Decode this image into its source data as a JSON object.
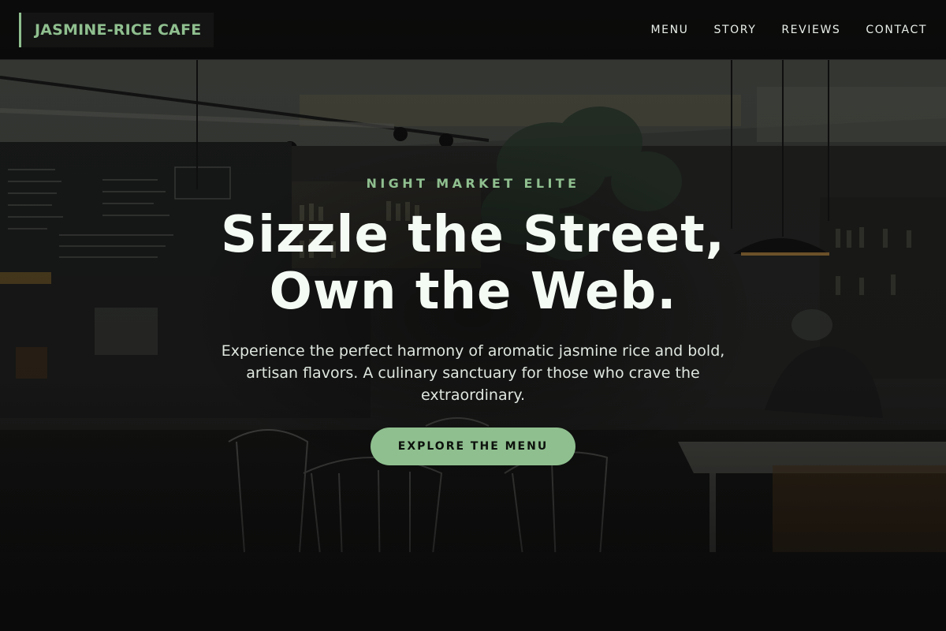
{
  "brand": {
    "name": "JASMINE-RICE CAFE",
    "accent_color": "#8fbf8f"
  },
  "nav": {
    "items": [
      {
        "label": "MENU"
      },
      {
        "label": "STORY"
      },
      {
        "label": "REVIEWS"
      },
      {
        "label": "CONTACT"
      }
    ]
  },
  "hero": {
    "eyebrow": "NIGHT MARKET ELITE",
    "headline_line1": "Sizzle the Street,",
    "headline_line2": "Own the Web.",
    "lede": "Experience the perfect harmony of aromatic jasmine rice and bold, artisan flavors. A culinary sanctuary for those who crave the extraordinary.",
    "cta_label": "EXPLORE THE MENU",
    "background_image": "cafe-interior-photo"
  }
}
